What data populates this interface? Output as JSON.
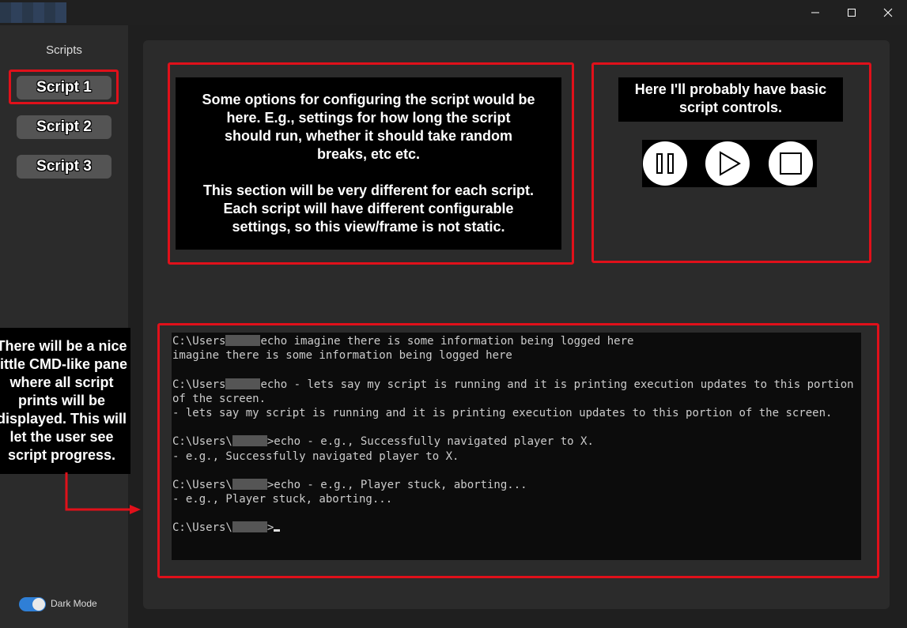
{
  "window": {
    "controls": {
      "minimize_icon": "minimize-icon",
      "maximize_icon": "maximize-icon",
      "close_icon": "close-icon"
    }
  },
  "sidebar": {
    "title": "Scripts",
    "items": [
      {
        "label": "Script 1",
        "selected": true
      },
      {
        "label": "Script 2",
        "selected": false
      },
      {
        "label": "Script 3",
        "selected": false
      }
    ],
    "dark_mode": {
      "label": "Dark Mode",
      "enabled": true
    }
  },
  "config_panel": {
    "paragraph1": "Some options for configuring the script would be\nhere. E.g., settings for how long the script\nshould run, whether it should take random\nbreaks, etc etc.",
    "paragraph2": "This section will be very different for each script.\nEach script will have different configurable\nsettings, so this view/frame is not static."
  },
  "controls_panel": {
    "text": "Here I'll probably have basic\nscript controls.",
    "buttons": [
      "pause-icon",
      "play-icon",
      "stop-icon"
    ]
  },
  "console": {
    "lines": [
      {
        "prompt": "C:\\Users",
        "cmd": "echo imagine there is some information being logged here"
      },
      {
        "text": "imagine there is some information being logged here"
      },
      {
        "blank": true
      },
      {
        "prompt": "C:\\Users",
        "cmd": "echo - lets say my script is running and it is printing execution updates to this portion"
      },
      {
        "text": "of the screen."
      },
      {
        "text": "- lets say my script is running and it is printing execution updates to this portion of the screen."
      },
      {
        "blank": true
      },
      {
        "prompt": "C:\\Users\\",
        "cmd": ">echo - e.g., Successfully navigated player to X."
      },
      {
        "text": "- e.g., Successfully navigated player to X."
      },
      {
        "blank": true
      },
      {
        "prompt": "C:\\Users\\",
        "cmd": ">echo - e.g., Player stuck, aborting..."
      },
      {
        "text": "- e.g., Player stuck, aborting..."
      },
      {
        "blank": true
      },
      {
        "prompt": "C:\\Users\\",
        "cmd": ">",
        "cursor": true
      }
    ]
  },
  "annotation": {
    "text": "There will be a nice\nlittle CMD-like pane\nwhere all script\nprints will be\ndisplayed. This will\nlet the user see\nscript progress."
  },
  "colors": {
    "highlight": "#e0101a",
    "accent": "#2f7fd6",
    "sidebar_bg": "#2b2b2b",
    "window_bg": "#1f1f1f"
  }
}
